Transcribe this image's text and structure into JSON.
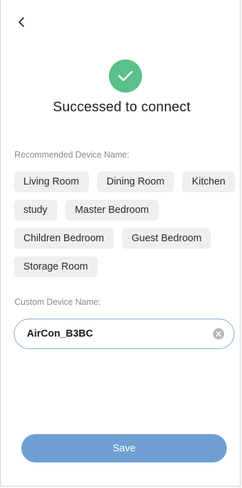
{
  "header": {
    "back_icon": "chevron-left-icon"
  },
  "status": {
    "icon": "check-circle-icon",
    "accent_color": "#5cc08a",
    "title": "Successed to connect"
  },
  "recommended": {
    "label": "Recommended Device Name:",
    "chips": [
      "Living Room",
      "Dining Room",
      "Kitchen",
      "study",
      "Master Bedroom",
      "Children Bedroom",
      "Guest Bedroom",
      "Storage Room"
    ]
  },
  "custom": {
    "label": "Custom Device Name:",
    "value": "AirCon_B3BC",
    "clear_icon": "clear-icon"
  },
  "actions": {
    "save_label": "Save",
    "save_color": "#6f9ed4"
  }
}
